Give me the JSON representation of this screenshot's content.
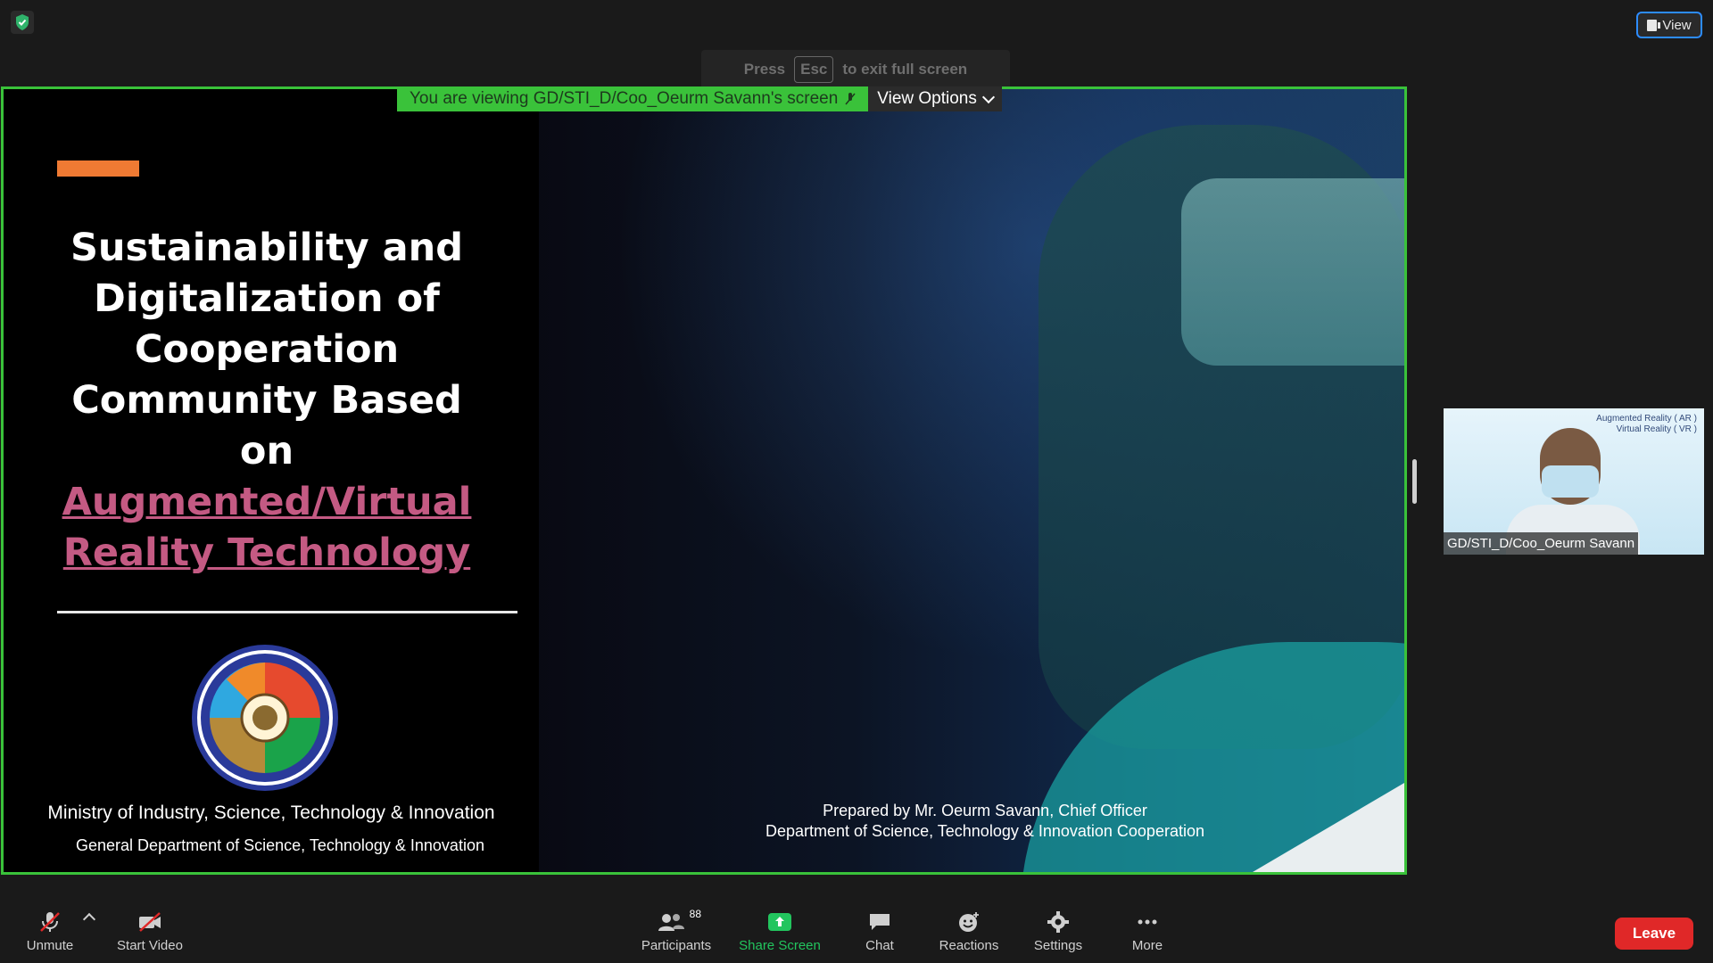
{
  "window": {
    "view_button_label": "View",
    "esc_hint": {
      "press": "Press",
      "key": "Esc",
      "rest": "to exit full screen"
    }
  },
  "share": {
    "viewing_message": "You are viewing GD/STI_D/Coo_Oeurm Savann's screen",
    "view_options_label": "View Options"
  },
  "slide": {
    "title_lines": [
      "Sustainability and",
      "Digitalization of",
      "Cooperation",
      "Community Based",
      "on"
    ],
    "highlight_lines": [
      "Augmented/Virtual",
      "Reality Technology"
    ],
    "ministry": "Ministry of Industry, Science, Technology & Innovation",
    "department": "General Department of Science, Technology & Innovation",
    "prepared_by": "Prepared by Mr. Oeurm Savann, Chief Officer",
    "prepared_dept": "Department of Science, Technology & Innovation Cooperation",
    "accent_color": "#ef7a33",
    "highlight_color": "#c45a83"
  },
  "participant": {
    "name": "GD/STI_D/Coo_Oeurm Savann",
    "bg_text": [
      "Augmented Reality ( AR )",
      "Virtual Reality ( VR )"
    ]
  },
  "toolbar": {
    "unmute": "Unmute",
    "start_video": "Start Video",
    "participants": "Participants",
    "participants_count": "88",
    "share_screen": "Share Screen",
    "chat": "Chat",
    "reactions": "Reactions",
    "settings": "Settings",
    "more": "More",
    "leave": "Leave"
  },
  "colors": {
    "share_border": "#3ac23a",
    "share_screen_icon": "#22c55e",
    "leave": "#e02828",
    "view_border": "#2d8cff"
  }
}
